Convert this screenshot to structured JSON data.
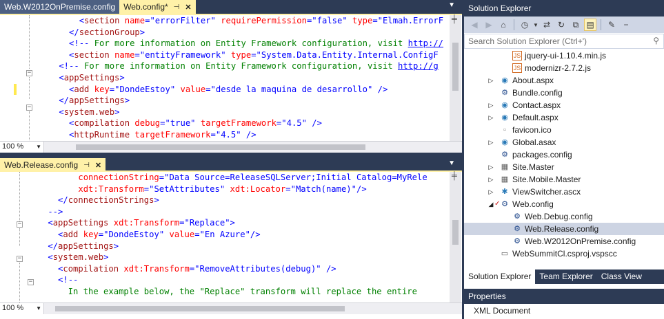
{
  "top_editor": {
    "tabs": [
      {
        "label": "Web.W2012OnPremise.config"
      },
      {
        "label": "Web.config*",
        "pin": "⊣",
        "close": "✕"
      }
    ],
    "zoom": "100 %",
    "lines": [
      {
        "parts": [
          {
            "k": "p",
            "s": "        <"
          },
          {
            "k": "t",
            "s": "section"
          },
          {
            "k": "a",
            "s": " name"
          },
          {
            "k": "p",
            "s": "=\""
          },
          {
            "k": "v",
            "s": "errorFilter"
          },
          {
            "k": "p",
            "s": "\""
          },
          {
            "k": "a",
            "s": " requirePermission"
          },
          {
            "k": "p",
            "s": "=\""
          },
          {
            "k": "v",
            "s": "false"
          },
          {
            "k": "p",
            "s": "\""
          },
          {
            "k": "a",
            "s": " type"
          },
          {
            "k": "p",
            "s": "=\""
          },
          {
            "k": "v",
            "s": "Elmah.ErrorF"
          }
        ]
      },
      {
        "parts": [
          {
            "k": "p",
            "s": "      </"
          },
          {
            "k": "t",
            "s": "sectionGroup"
          },
          {
            "k": "p",
            "s": ">"
          }
        ]
      },
      {
        "parts": [
          {
            "k": "p",
            "s": "      <!--"
          },
          {
            "k": "c",
            "s": " For more information on Entity Framework configuration, visit "
          },
          {
            "k": "u",
            "s": "http://"
          }
        ]
      },
      {
        "parts": [
          {
            "k": "p",
            "s": "      <"
          },
          {
            "k": "t",
            "s": "section"
          },
          {
            "k": "a",
            "s": " name"
          },
          {
            "k": "p",
            "s": "=\""
          },
          {
            "k": "v",
            "s": "entityFramework"
          },
          {
            "k": "p",
            "s": "\""
          },
          {
            "k": "a",
            "s": " type"
          },
          {
            "k": "p",
            "s": "=\""
          },
          {
            "k": "v",
            "s": "System.Data.Entity.Internal.ConfigF"
          }
        ]
      },
      {
        "parts": [
          {
            "k": "p",
            "s": "    <!--"
          },
          {
            "k": "c",
            "s": " For more information on Entity Framework configuration, visit "
          },
          {
            "k": "u",
            "s": "http://g"
          }
        ]
      },
      {
        "parts": [
          {
            "k": "p",
            "s": "    <"
          },
          {
            "k": "t",
            "s": "appSettings"
          },
          {
            "k": "p",
            "s": ">"
          }
        ]
      },
      {
        "parts": [
          {
            "k": "p",
            "s": "      <"
          },
          {
            "k": "t",
            "s": "add"
          },
          {
            "k": "a",
            "s": " key"
          },
          {
            "k": "p",
            "s": "=\""
          },
          {
            "k": "v",
            "s": "DondeEstoy"
          },
          {
            "k": "p",
            "s": "\""
          },
          {
            "k": "a",
            "s": " value"
          },
          {
            "k": "p",
            "s": "=\""
          },
          {
            "k": "v",
            "s": "desde la maquina de desarrollo"
          },
          {
            "k": "p",
            "s": "\" />"
          }
        ]
      },
      {
        "parts": [
          {
            "k": "p",
            "s": "    </"
          },
          {
            "k": "t",
            "s": "appSettings"
          },
          {
            "k": "p",
            "s": ">"
          }
        ]
      },
      {
        "parts": [
          {
            "k": "p",
            "s": "    <"
          },
          {
            "k": "t",
            "s": "system.web"
          },
          {
            "k": "p",
            "s": ">"
          }
        ]
      },
      {
        "parts": [
          {
            "k": "p",
            "s": "      <"
          },
          {
            "k": "t",
            "s": "compilation"
          },
          {
            "k": "a",
            "s": " debug"
          },
          {
            "k": "p",
            "s": "=\""
          },
          {
            "k": "v",
            "s": "true"
          },
          {
            "k": "p",
            "s": "\""
          },
          {
            "k": "a",
            "s": " targetFramework"
          },
          {
            "k": "p",
            "s": "=\""
          },
          {
            "k": "v",
            "s": "4.5"
          },
          {
            "k": "p",
            "s": "\" />"
          }
        ]
      },
      {
        "parts": [
          {
            "k": "p",
            "s": "      <"
          },
          {
            "k": "t",
            "s": "httpRuntime"
          },
          {
            "k": "a",
            "s": " targetFramework"
          },
          {
            "k": "p",
            "s": "=\""
          },
          {
            "k": "v",
            "s": "4.5"
          },
          {
            "k": "p",
            "s": "\" />"
          }
        ]
      }
    ]
  },
  "bottom_editor": {
    "tabs": [
      {
        "label": "Web.Release.config",
        "pin": "⊣",
        "close": "✕"
      }
    ],
    "zoom": "100 %",
    "lines": [
      {
        "parts": [
          {
            "k": "a",
            "s": "          connectionString"
          },
          {
            "k": "p",
            "s": "=\""
          },
          {
            "k": "v",
            "s": "Data Source=ReleaseSQLServer;Initial Catalog=MyRele"
          }
        ]
      },
      {
        "parts": [
          {
            "k": "a",
            "s": "          xdt:Transform"
          },
          {
            "k": "p",
            "s": "=\""
          },
          {
            "k": "v",
            "s": "SetAttributes"
          },
          {
            "k": "p",
            "s": "\""
          },
          {
            "k": "a",
            "s": " xdt:Locator"
          },
          {
            "k": "p",
            "s": "=\""
          },
          {
            "k": "v",
            "s": "Match(name)"
          },
          {
            "k": "p",
            "s": "\"/>"
          }
        ]
      },
      {
        "parts": [
          {
            "k": "p",
            "s": "      </"
          },
          {
            "k": "t",
            "s": "connectionStrings"
          },
          {
            "k": "p",
            "s": ">"
          }
        ]
      },
      {
        "parts": [
          {
            "k": "p",
            "s": "    -->"
          }
        ]
      },
      {
        "parts": [
          {
            "k": "p",
            "s": "    <"
          },
          {
            "k": "t",
            "s": "appSettings"
          },
          {
            "k": "a",
            "s": " xdt:Transform"
          },
          {
            "k": "p",
            "s": "=\""
          },
          {
            "k": "v",
            "s": "Replace"
          },
          {
            "k": "p",
            "s": "\">"
          }
        ]
      },
      {
        "parts": [
          {
            "k": "p",
            "s": "      <"
          },
          {
            "k": "t",
            "s": "add"
          },
          {
            "k": "a",
            "s": " key"
          },
          {
            "k": "p",
            "s": "=\""
          },
          {
            "k": "v",
            "s": "DondeEstoy"
          },
          {
            "k": "p",
            "s": "\""
          },
          {
            "k": "a",
            "s": " value"
          },
          {
            "k": "p",
            "s": "=\""
          },
          {
            "k": "v",
            "s": "En Azure"
          },
          {
            "k": "p",
            "s": "\"/>"
          }
        ]
      },
      {
        "parts": [
          {
            "k": "p",
            "s": "    </"
          },
          {
            "k": "t",
            "s": "appSettings"
          },
          {
            "k": "p",
            "s": ">"
          }
        ]
      },
      {
        "parts": [
          {
            "k": "p",
            "s": "    <"
          },
          {
            "k": "t",
            "s": "system.web"
          },
          {
            "k": "p",
            "s": ">"
          }
        ]
      },
      {
        "parts": [
          {
            "k": "p",
            "s": "      <"
          },
          {
            "k": "t",
            "s": "compilation"
          },
          {
            "k": "a",
            "s": " xdt:Transform"
          },
          {
            "k": "p",
            "s": "=\""
          },
          {
            "k": "v",
            "s": "RemoveAttributes(debug)"
          },
          {
            "k": "p",
            "s": "\" />"
          }
        ]
      },
      {
        "parts": [
          {
            "k": "p",
            "s": "      <!--"
          }
        ]
      },
      {
        "parts": [
          {
            "k": "c",
            "s": "        In the example below, the \"Replace\" transform will replace the entire"
          }
        ]
      }
    ]
  },
  "solution_explorer": {
    "title": "Solution Explorer",
    "search_placeholder": "Search Solution Explorer (Ctrl+')",
    "items": [
      {
        "label": "jquery-ui-1.10.4.min.js",
        "icon": "js-file-icon",
        "indent": 3,
        "expander": ""
      },
      {
        "label": "modernizr-2.7.2.js",
        "icon": "js-file-icon",
        "indent": 3,
        "expander": ""
      },
      {
        "label": "About.aspx",
        "icon": "web-form-icon",
        "indent": 2,
        "expander": "▷"
      },
      {
        "label": "Bundle.config",
        "icon": "config-file-icon",
        "indent": 2,
        "expander": ""
      },
      {
        "label": "Contact.aspx",
        "icon": "web-form-icon",
        "indent": 2,
        "expander": "▷"
      },
      {
        "label": "Default.aspx",
        "icon": "web-form-icon",
        "indent": 2,
        "expander": "▷"
      },
      {
        "label": "favicon.ico",
        "icon": "icon-file-icon",
        "indent": 2,
        "expander": ""
      },
      {
        "label": "Global.asax",
        "icon": "global-asax-icon",
        "indent": 2,
        "expander": "▷"
      },
      {
        "label": "packages.config",
        "icon": "config-file-icon",
        "indent": 2,
        "expander": ""
      },
      {
        "label": "Site.Master",
        "icon": "master-page-icon",
        "indent": 2,
        "expander": "▷"
      },
      {
        "label": "Site.Mobile.Master",
        "icon": "master-page-icon",
        "indent": 2,
        "expander": "▷"
      },
      {
        "label": "ViewSwitcher.ascx",
        "icon": "user-control-icon",
        "indent": 2,
        "expander": "▷"
      },
      {
        "label": "Web.config",
        "icon": "config-file-icon",
        "indent": 2,
        "expander": "◢",
        "checked": true
      },
      {
        "label": "Web.Debug.config",
        "icon": "config-file-icon",
        "indent": 3,
        "expander": ""
      },
      {
        "label": "Web.Release.config",
        "icon": "config-file-icon",
        "indent": 3,
        "expander": "",
        "selected": true
      },
      {
        "label": "Web.W2012OnPremise.config",
        "icon": "config-file-icon",
        "indent": 3,
        "expander": ""
      },
      {
        "label": "WebSummitCl.csproj.vspscc",
        "icon": "project-file-icon",
        "indent": 2,
        "expander": ""
      }
    ],
    "bottom_tabs": [
      "Solution Explorer",
      "Team Explorer",
      "Class View"
    ]
  },
  "properties": {
    "title": "Properties",
    "value": "XML Document"
  },
  "colors": {
    "chrome": "#2d3b55",
    "active_tab": "#fff1a8",
    "selected_row": "#cdd4e3"
  }
}
